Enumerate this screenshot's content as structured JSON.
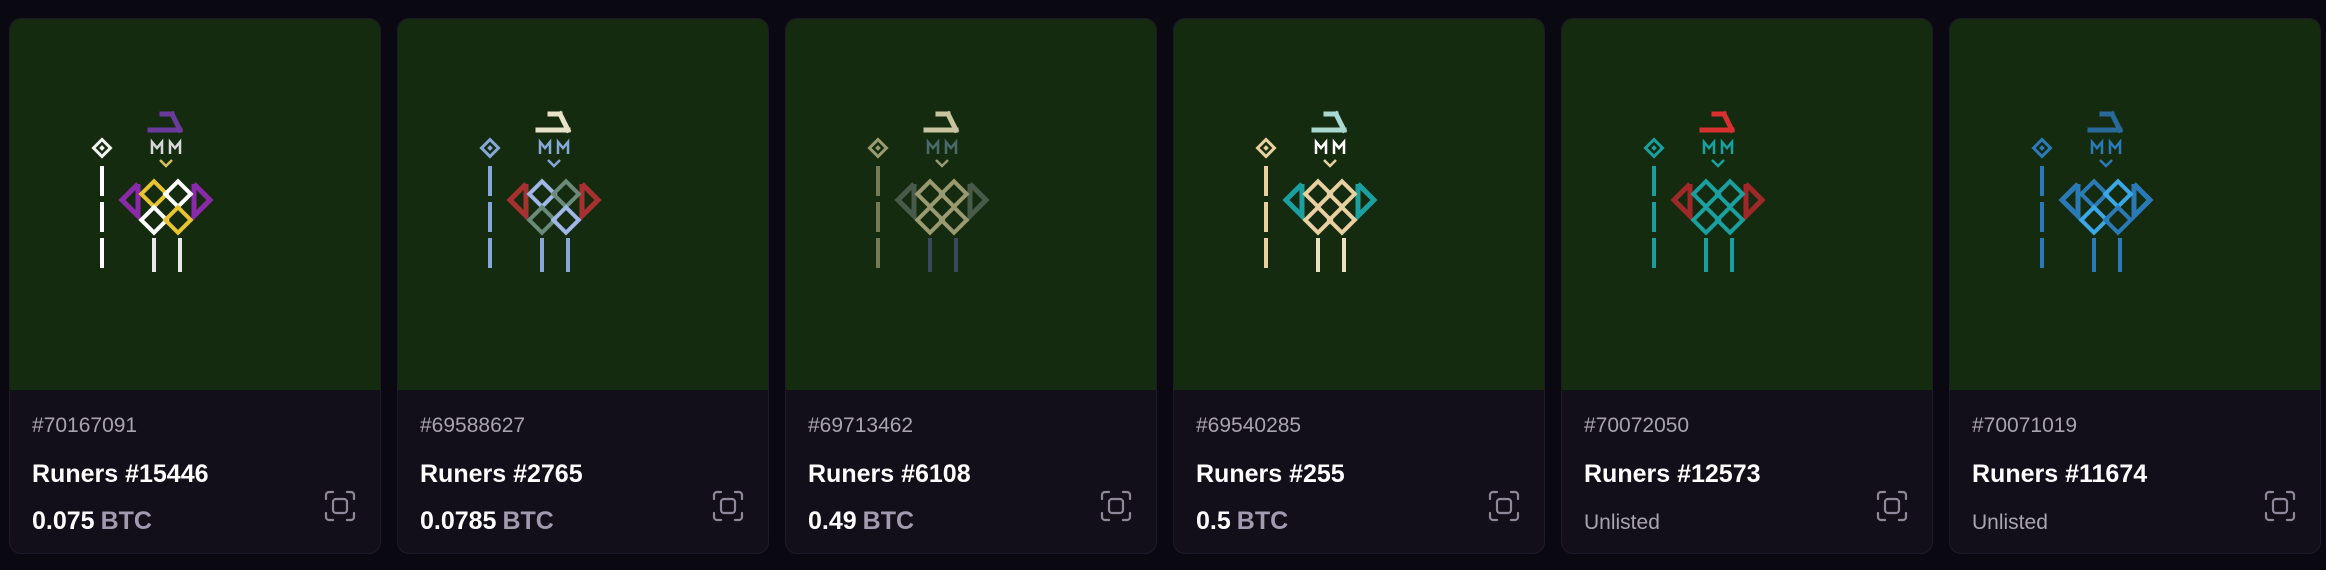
{
  "cards": [
    {
      "inscription": "#70167091",
      "name": "Runers #15446",
      "price": "0.075",
      "currency": "BTC",
      "unlisted": "",
      "colors": {
        "hat": "#6a3a9c",
        "staff": "#ffffff",
        "gem": "#f2f2f2",
        "eyes": "#d8d8d8",
        "mouth": "#d8c060",
        "wings": "#8a2aa8",
        "body1": "#e8c530",
        "body2": "#ffffff",
        "legs": "#e8e8e8"
      }
    },
    {
      "inscription": "#69588627",
      "name": "Runers #2765",
      "price": "0.0785",
      "currency": "BTC",
      "unlisted": "",
      "colors": {
        "hat": "#e8e2c8",
        "staff": "#86a8d8",
        "gem": "#86a8d8",
        "eyes": "#86a8d8",
        "mouth": "#86a8d8",
        "wings": "#a83030",
        "body1": "#a0b8e8",
        "body2": "#6a8a7a",
        "legs": "#86a8d8"
      }
    },
    {
      "inscription": "#69713462",
      "name": "Runers #6108",
      "price": "0.49",
      "currency": "BTC",
      "unlisted": "",
      "colors": {
        "hat": "#c8c4a0",
        "staff": "#7a7a50",
        "gem": "#9a9a70",
        "eyes": "#4a6a6a",
        "mouth": "#9a9a70",
        "wings": "#4a5a4a",
        "body1": "#9a9a70",
        "body2": "#9a9a70",
        "legs": "#3a4a5a"
      }
    },
    {
      "inscription": "#69540285",
      "name": "Runers #255",
      "price": "0.5",
      "currency": "BTC",
      "unlisted": "",
      "colors": {
        "hat": "#a8d8d0",
        "staff": "#e8d0a0",
        "gem": "#e8d0a0",
        "eyes": "#ffffff",
        "mouth": "#e8d0a0",
        "wings": "#1aa0a0",
        "body1": "#e8d0a0",
        "body2": "#e8d0a0",
        "legs": "#e8e0c0"
      }
    },
    {
      "inscription": "#70072050",
      "name": "Runers #12573",
      "price": "",
      "currency": "",
      "unlisted": "Unlisted",
      "colors": {
        "hat": "#d83030",
        "staff": "#1aa0a0",
        "gem": "#1aa0a0",
        "eyes": "#1aa0a0",
        "mouth": "#1aa0a0",
        "wings": "#a02828",
        "body1": "#1aa0a0",
        "body2": "#1aa0a0",
        "legs": "#1aa0a0"
      }
    },
    {
      "inscription": "#70071019",
      "name": "Runers #11674",
      "price": "",
      "currency": "",
      "unlisted": "Unlisted",
      "colors": {
        "hat": "#2a6a9a",
        "staff": "#2a7ab8",
        "gem": "#2a7ab8",
        "eyes": "#2a7ab8",
        "mouth": "#2a7ab8",
        "wings": "#2a7ab8",
        "body1": "#2a7ab8",
        "body2": "#3aa8e8",
        "legs": "#2a7ab8"
      }
    }
  ],
  "icons": {
    "scan": "scan-icon"
  }
}
